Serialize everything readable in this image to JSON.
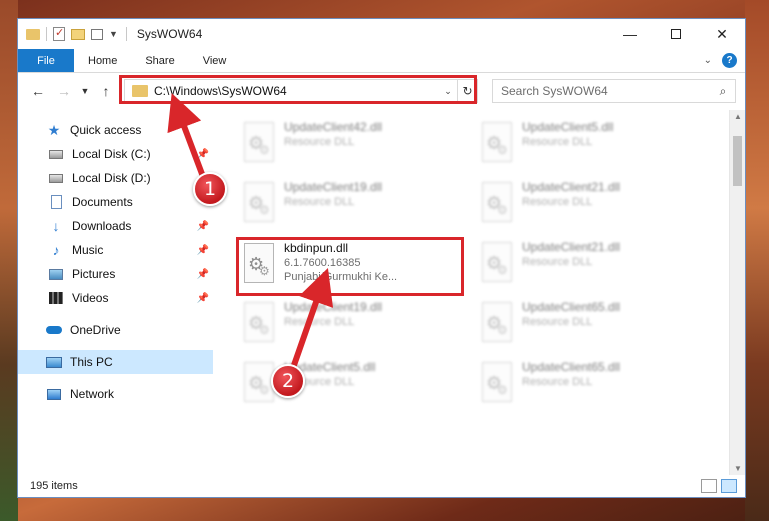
{
  "window": {
    "title": "SysWOW64",
    "minimize_glyph": "—",
    "close_glyph": "✕"
  },
  "ribbon": {
    "tabs": [
      "File",
      "Home",
      "Share",
      "View"
    ],
    "help_glyph": "?"
  },
  "nav": {
    "address_path": "C:\\Windows\\SysWOW64",
    "search_placeholder": "Search SysWOW64"
  },
  "sidebar": {
    "items": [
      {
        "label": "Quick access",
        "icon": "star-icon"
      },
      {
        "label": "Local Disk (C:)",
        "icon": "drive-icon",
        "pinned": true
      },
      {
        "label": "Local Disk (D:)",
        "icon": "drive-icon"
      },
      {
        "label": "Documents",
        "icon": "documents-icon"
      },
      {
        "label": "Downloads",
        "icon": "downloads-icon",
        "pinned": true
      },
      {
        "label": "Music",
        "icon": "music-icon",
        "pinned": true
      },
      {
        "label": "Pictures",
        "icon": "pictures-icon",
        "pinned": true
      },
      {
        "label": "Videos",
        "icon": "videos-icon",
        "pinned": true
      },
      {
        "label": "OneDrive",
        "icon": "onedrive-icon"
      },
      {
        "label": "This PC",
        "icon": "this-pc-icon",
        "selected": true
      },
      {
        "label": "Network",
        "icon": "network-icon"
      }
    ]
  },
  "files": {
    "left": [
      {
        "name": "UpdateClient42.dll",
        "line2": "Resource DLL"
      },
      {
        "name": "UpdateClient19.dll",
        "line2": "Resource DLL"
      },
      {
        "name": "kbdinpun.dll",
        "line2": "6.1.7600.16385",
        "line3": "Punjabi/Gurmukhi Ke..."
      },
      {
        "name": "UpdateClient19.dll",
        "line2": "Resource DLL"
      },
      {
        "name": "UpdateClient5.dll",
        "line2": "Resource DLL"
      }
    ],
    "right": [
      {
        "name": "UpdateClient5.dll",
        "line2": "Resource DLL"
      },
      {
        "name": "UpdateClient21.dll",
        "line2": "Resource DLL"
      },
      {
        "name": "UpdateClient21.dll",
        "line2": "Resource DLL"
      },
      {
        "name": "UpdateClient65.dll",
        "line2": "Resource DLL"
      },
      {
        "name": "UpdateClient65.dll",
        "line2": "Resource DLL"
      }
    ]
  },
  "status": {
    "item_count": "195 items"
  },
  "callouts": {
    "step1": "1",
    "step2": "2",
    "color": "#d9262a"
  }
}
